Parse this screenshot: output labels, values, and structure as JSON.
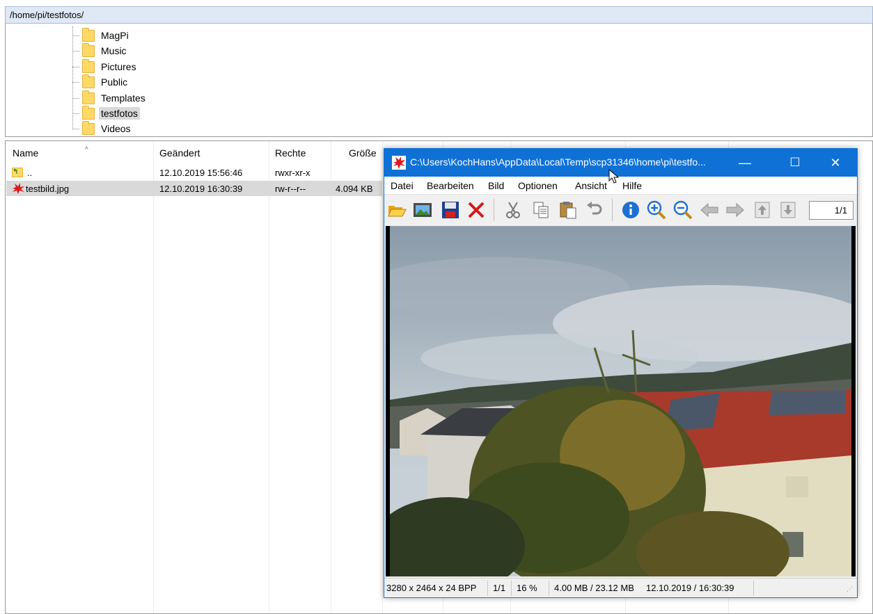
{
  "path": "/home/pi/testfotos/",
  "tree": {
    "items": [
      {
        "label": "MagPi",
        "selected": false
      },
      {
        "label": "Music",
        "selected": false
      },
      {
        "label": "Pictures",
        "selected": false
      },
      {
        "label": "Public",
        "selected": false
      },
      {
        "label": "Templates",
        "selected": false
      },
      {
        "label": "testfotos",
        "selected": true
      },
      {
        "label": "Videos",
        "selected": false
      }
    ]
  },
  "file_list": {
    "columns": [
      "Name",
      "Geändert",
      "Rechte",
      "Größe"
    ],
    "rows": [
      {
        "name": "..",
        "changed": "12.10.2019 15:56:46",
        "rights": "rwxr-xr-x",
        "size": "",
        "icon": "parent-folder-icon"
      },
      {
        "name": "testbild.jpg",
        "changed": "12.10.2019 16:30:39",
        "rights": "rw-r--r--",
        "size": "4.094 KB",
        "icon": "irfanview-image-icon"
      }
    ]
  },
  "viewer": {
    "title": "C:\\Users\\KochHans\\AppData\\Local\\Temp\\scp31346\\home\\pi\\testfo...",
    "window_buttons": {
      "minimize": "—",
      "maximize": "☐",
      "close": "✕"
    },
    "menu": [
      "Datei",
      "Bearbeiten",
      "Bild",
      "Optionen",
      "Ansicht",
      "Hilfe"
    ],
    "toolbar": [
      "open-folder-icon",
      "slideshow-icon",
      "save-icon",
      "delete-icon",
      "cut-icon",
      "copy-icon",
      "paste-icon",
      "undo-icon",
      "info-icon",
      "zoom-in-icon",
      "zoom-out-icon",
      "previous-arrow-icon",
      "next-arrow-icon",
      "page-up-icon",
      "page-down-icon"
    ],
    "page_indicator": "1/1",
    "status": {
      "dimensions": "3280 x 2464 x 24 BPP",
      "index": "1/1",
      "zoom": "16 %",
      "memory": "4.00 MB / 23.12 MB",
      "datetime": "12.10.2019 / 16:30:39"
    },
    "colors": {
      "titlebar": "#0f71d6",
      "selection": "#d9d9d9"
    }
  }
}
